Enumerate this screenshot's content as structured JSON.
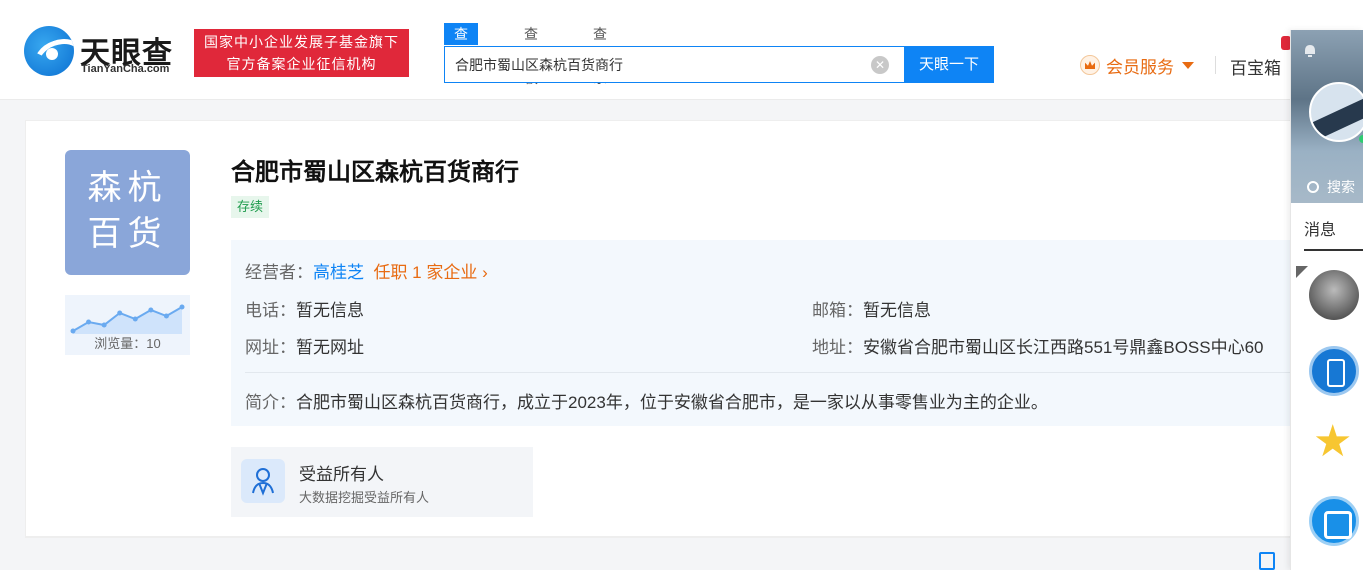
{
  "header": {
    "logo_cn": "天眼查",
    "logo_en": "TianYanCha.com",
    "badge_line1": "国家中小企业发展子基金旗下",
    "badge_line2": "官方备案企业征信机构",
    "tabs": [
      {
        "label": "查公司",
        "active": true
      },
      {
        "label": "查老板",
        "active": false
      },
      {
        "label": "查关系",
        "active": false
      }
    ],
    "search_value": "合肥市蜀山区森杭百货商行",
    "search_button": "天眼一下",
    "member_label": "会员服务",
    "treasure_label": "百宝箱"
  },
  "company": {
    "avatar_text_line1": "森杭",
    "avatar_text_line2": "百货",
    "views_label": "浏览量：10",
    "views_trend": [
      3,
      6,
      5,
      9,
      7,
      10,
      8,
      11
    ],
    "name": "合肥市蜀山区森杭百货商行",
    "status": "存续",
    "operator_label": "经营者：",
    "operator_name": "高桂芝",
    "operator_positions": "任职 1 家企业",
    "phone_label": "电话：",
    "phone_value": "暂无信息",
    "email_label": "邮箱：",
    "email_value": "暂无信息",
    "website_label": "网址：",
    "website_value": "暂无网址",
    "address_label": "地址：",
    "address_value": "安徽省合肥市蜀山区长江西路551号鼎鑫BOSS中心60",
    "intro_label": "简介：",
    "intro_value": "合肥市蜀山区森杭百货商行，成立于2023年，位于安徽省合肥市，是一家以从事零售业为主的企业。",
    "beneficiary_title": "受益所有人",
    "beneficiary_sub": "大数据挖掘受益所有人"
  },
  "sidebar": {
    "search_label": "搜索",
    "messages_label": "消息"
  },
  "colors": {
    "primary": "#0e84f5",
    "badge_red": "#e0283a",
    "member_orange": "#e86b12",
    "status_green": "#1f9c4d"
  }
}
